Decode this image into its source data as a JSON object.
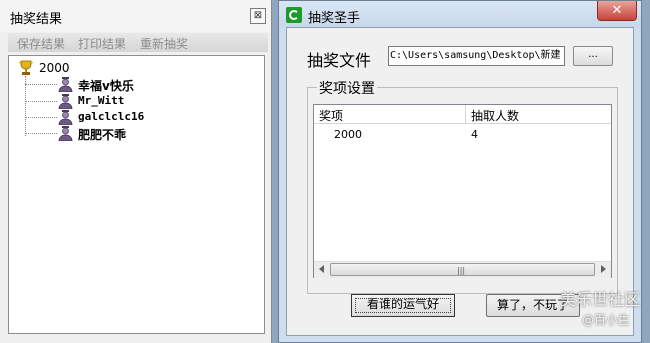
{
  "results_window": {
    "title": "抽奖结果",
    "close_label": "⊠",
    "menu": [
      "保存结果",
      "打印结果",
      "重新抽奖"
    ],
    "tree": {
      "root_label": "2000",
      "children": [
        "幸福v快乐",
        "Mr_Witt",
        "galclclc16",
        "肥肥不乖"
      ]
    }
  },
  "main_window": {
    "title": "抽奖圣手",
    "close_label": "✕",
    "file_label": "抽奖文件",
    "file_path": "C:\\Users\\samsung\\Desktop\\新建",
    "browse_label": "...",
    "group_label": "奖项设置",
    "columns": [
      "奖项",
      "抽取人数"
    ],
    "rows": [
      {
        "prize": "2000",
        "count": "4"
      }
    ],
    "scroll_grip": "|||",
    "buttons": {
      "draw": "看谁的运气好",
      "quit": "算了，不玩了"
    }
  },
  "watermark": {
    "line1": "美乐世社区",
    "line2": "@百小生"
  }
}
